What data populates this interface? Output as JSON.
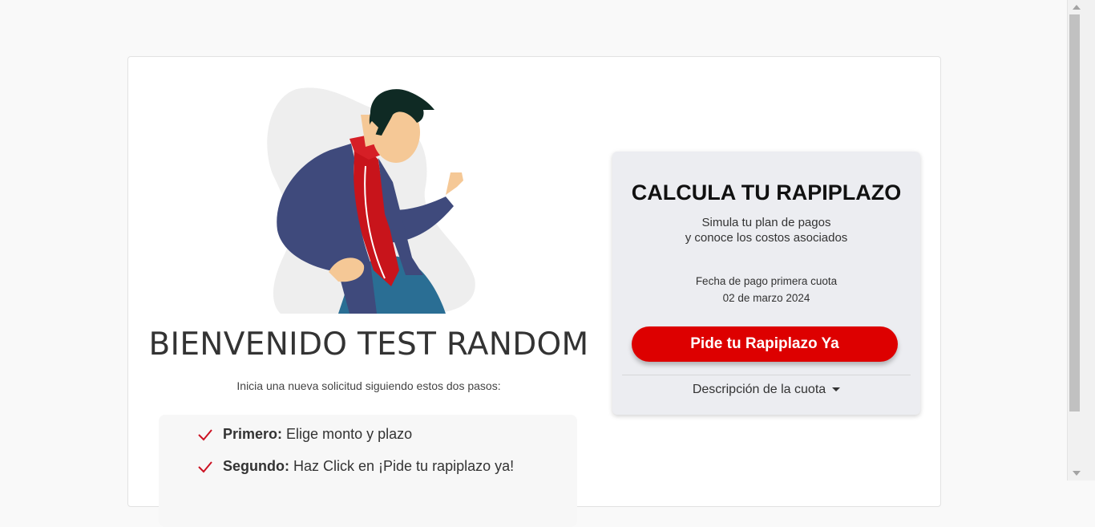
{
  "welcome": {
    "title": "BIENVENIDO TEST RANDOM",
    "subtitle": "Inicia una nueva solicitud siguiendo estos dos pasos:"
  },
  "steps": [
    {
      "label": "Primero:",
      "text": "Elige monto y plazo"
    },
    {
      "label": "Segundo:",
      "text": "Haz Click en ¡Pide tu rapiplazo ya!"
    }
  ],
  "calculator": {
    "title": "CALCULA TU RAPIPLAZO",
    "line1": "Simula tu plan de pagos",
    "line2": "y conoce los costos asociados",
    "date_label": "Fecha de pago primera cuota",
    "date_value": "02 de marzo 2024",
    "button_label": "Pide tu Rapiplazo Ya",
    "description_toggle": "Descripción de la cuota"
  },
  "colors": {
    "accent": "#dd0000",
    "check": "#cc1122",
    "card_bg": "#ecedf1"
  },
  "icons": {
    "check": "check-icon",
    "caret": "caret-down-icon"
  }
}
